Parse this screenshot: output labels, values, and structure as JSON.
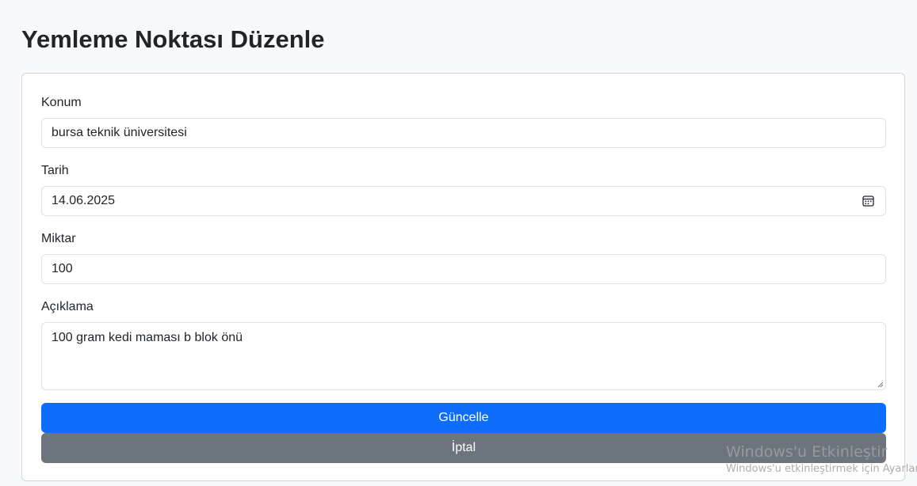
{
  "page": {
    "title": "Yemleme Noktası Düzenle"
  },
  "form": {
    "location": {
      "label": "Konum",
      "value": "bursa teknik üniversitesi"
    },
    "date": {
      "label": "Tarih",
      "value": "14.06.2025",
      "icon": "calendar-icon"
    },
    "amount": {
      "label": "Miktar",
      "value": "100"
    },
    "description": {
      "label": "Açıklama",
      "value": "100 gram kedi maması b blok önü"
    },
    "update_button": {
      "label": "Güncelle",
      "color": "#0d6efd"
    },
    "cancel_button": {
      "label": "İptal",
      "color": "#6c757d"
    }
  },
  "watermark": {
    "title": "Windows'u Etkinleştir",
    "subtitle": "Windows'u etkinleştirmek için Ayarlar'a gidin."
  }
}
